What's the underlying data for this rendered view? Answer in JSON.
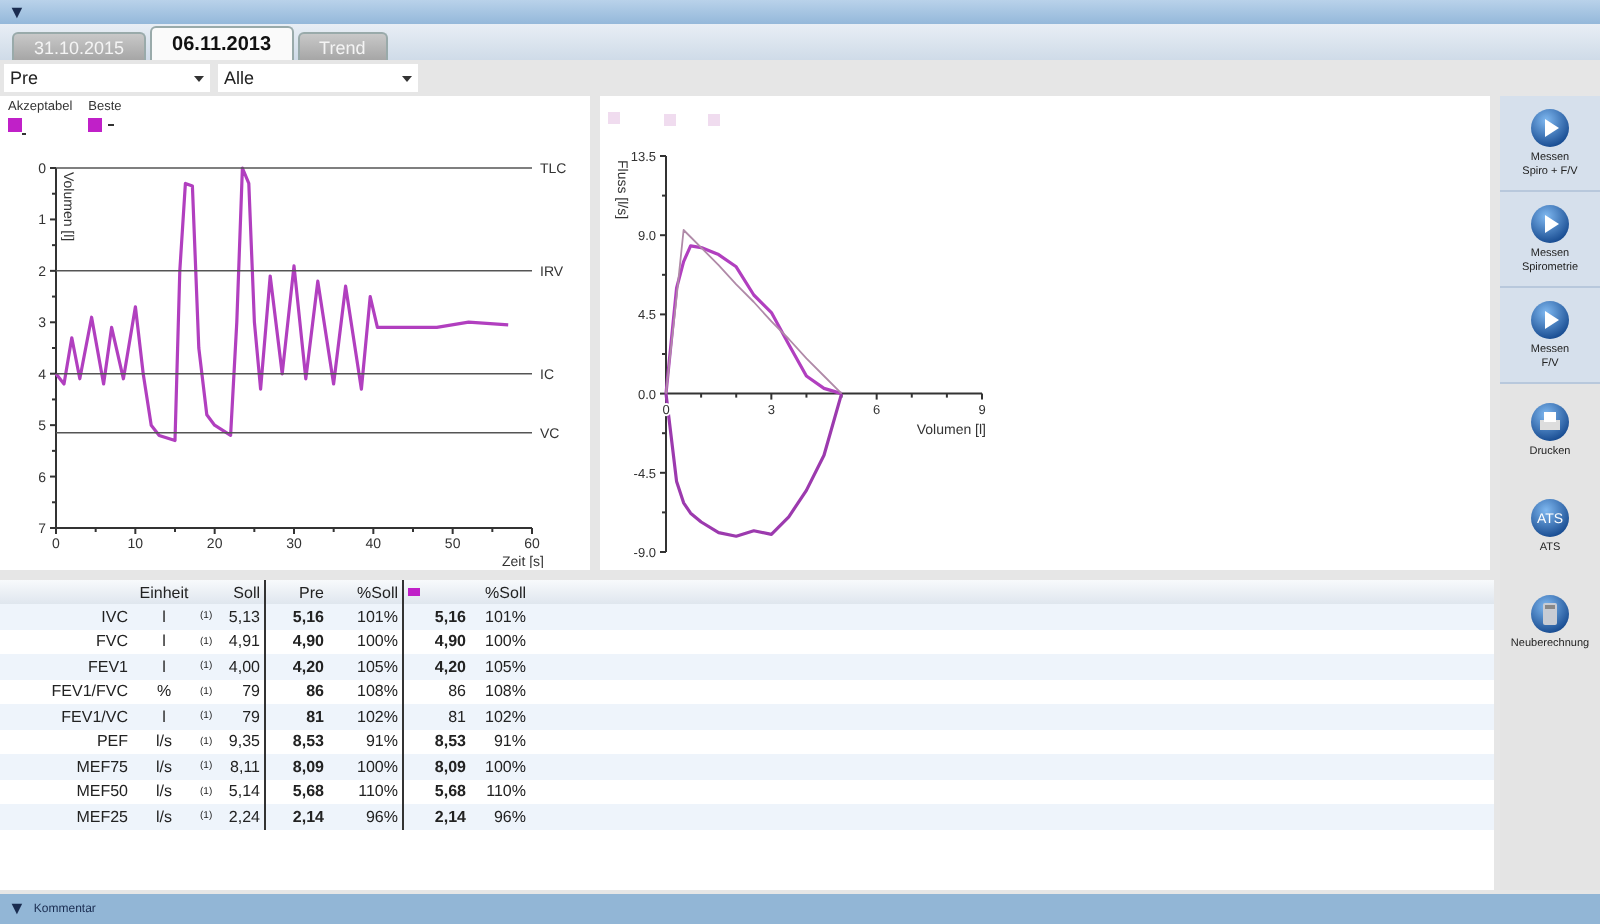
{
  "top_bar": {
    "glyph": "▼"
  },
  "tabs": [
    {
      "label": "31.10.2015",
      "selected": false
    },
    {
      "label": "06.11.2013",
      "selected": true
    },
    {
      "label": "Trend",
      "selected": false
    }
  ],
  "filters": [
    {
      "value": "Pre"
    },
    {
      "value": "Alle"
    }
  ],
  "volume_chart": {
    "legend": [
      {
        "label": "Akzeptabel",
        "kind": "accepted"
      },
      {
        "label": "Beste",
        "kind": "best"
      }
    ],
    "chart_data": {
      "type": "line",
      "xlabel": "Zeit [s]",
      "ylabel": "Volumen [l]",
      "x": [
        0,
        1,
        2,
        3,
        4.5,
        6,
        7,
        8.5,
        10,
        11,
        12,
        13,
        15,
        15.6,
        16.3,
        17.2,
        18,
        19,
        20,
        22,
        22.8,
        23.5,
        24.3,
        25,
        25.8,
        27,
        28.5,
        30,
        31.5,
        33,
        35,
        36.5,
        38.5,
        39.6,
        40.5,
        48,
        52,
        57,
        60
      ],
      "series": [
        {
          "color": "#b13fbf",
          "values": [
            4.0,
            4.2,
            3.3,
            4.1,
            2.9,
            4.2,
            3.1,
            4.1,
            2.7,
            4.0,
            5.0,
            5.2,
            5.3,
            2.0,
            0.3,
            0.35,
            3.5,
            4.8,
            5.0,
            5.2,
            3.0,
            0.0,
            0.3,
            3.0,
            4.3,
            2.1,
            4.0,
            1.9,
            4.1,
            2.2,
            4.2,
            2.3,
            4.3,
            2.5,
            3.1,
            3.1,
            3.0,
            3.05,
            null
          ]
        },
        {
          "name": "TLC",
          "color": "#555555",
          "values": [
            0,
            0,
            0,
            0,
            0,
            0,
            0,
            0,
            0,
            0,
            0,
            0,
            0,
            0,
            0,
            0,
            0,
            0,
            0,
            0,
            0,
            0,
            0,
            0,
            0,
            0,
            0,
            0,
            0,
            0,
            0,
            0,
            0,
            0,
            0,
            0,
            0,
            0,
            0
          ]
        },
        {
          "name": "IRV",
          "color": "#555555",
          "values": [
            2,
            2,
            2,
            2,
            2,
            2,
            2,
            2,
            2,
            2,
            2,
            2,
            2,
            2,
            2,
            2,
            2,
            2,
            2,
            2,
            2,
            2,
            2,
            2,
            2,
            2,
            2,
            2,
            2,
            2,
            2,
            2,
            2,
            2,
            2,
            2,
            2,
            2,
            2
          ]
        },
        {
          "name": "IC",
          "color": "#555555",
          "values": [
            4,
            4,
            4,
            4,
            4,
            4,
            4,
            4,
            4,
            4,
            4,
            4,
            4,
            4,
            4,
            4,
            4,
            4,
            4,
            4,
            4,
            4,
            4,
            4,
            4,
            4,
            4,
            4,
            4,
            4,
            4,
            4,
            4,
            4,
            4,
            4,
            4,
            4,
            4
          ]
        },
        {
          "name": "VC",
          "color": "#555555",
          "values": [
            5.15,
            5.15,
            5.15,
            5.15,
            5.15,
            5.15,
            5.15,
            5.15,
            5.15,
            5.15,
            5.15,
            5.15,
            5.15,
            5.15,
            5.15,
            5.15,
            5.15,
            5.15,
            5.15,
            5.15,
            5.15,
            5.15,
            5.15,
            5.15,
            5.15,
            5.15,
            5.15,
            5.15,
            5.15,
            5.15,
            5.15,
            5.15,
            5.15,
            5.15,
            5.15,
            5.15,
            5.15,
            5.15,
            5.15
          ]
        }
      ],
      "xlim": [
        0,
        60
      ],
      "ylim": [
        7,
        0
      ],
      "xticks": [
        0,
        10,
        20,
        30,
        40,
        50,
        60
      ],
      "yticks": [
        0,
        1,
        2,
        3,
        4,
        5,
        6,
        7
      ]
    }
  },
  "flow_chart": {
    "chart_data": {
      "type": "line",
      "xlabel": "Volumen [l]",
      "ylabel": "Fluss [l/s]",
      "x": [
        0,
        0.3,
        0.5,
        0.7,
        1,
        1.5,
        2,
        2.5,
        3,
        3.5,
        4,
        4.5,
        5
      ],
      "series": [
        {
          "color": "#b13fbf",
          "values": [
            0,
            6,
            7.5,
            8.4,
            8.3,
            7.9,
            7.2,
            5.6,
            4.6,
            2.8,
            1,
            0.3,
            0
          ]
        },
        {
          "color": "#9c3aae",
          "values": [
            0,
            -5,
            -6.2,
            -6.8,
            -7.3,
            -7.9,
            -8.1,
            -7.8,
            -8,
            -7,
            -5.5,
            -3.5,
            0
          ]
        },
        {
          "color": "#b08aa8",
          "values": [
            0,
            5.5,
            9.3,
            8.9,
            8.3,
            7.3,
            6.2,
            5.2,
            4.1,
            3.1,
            2.0,
            1.0,
            0
          ]
        }
      ],
      "xlim": [
        0,
        9
      ],
      "ylim": [
        -9,
        13.5
      ],
      "xticks": [
        0,
        3,
        6,
        9
      ],
      "yticks": [
        {
          "value": -9,
          "label": "-9.0"
        },
        {
          "value": -4.5,
          "label": "-4.5"
        },
        {
          "value": 0,
          "label": "0.0"
        },
        {
          "value": 4.5,
          "label": "4.5"
        },
        {
          "value": 9,
          "label": "9.0"
        },
        {
          "value": 13.5,
          "label": "13.5"
        }
      ]
    }
  },
  "sidebar": {
    "buttons": [
      {
        "label": "Messen\nSpiro + F/V",
        "kind": "play",
        "highlighted": true
      },
      {
        "label": "Messen\nSpirometrie",
        "kind": "play",
        "highlighted": true
      },
      {
        "label": "Messen\nF/V",
        "kind": "play",
        "highlighted": true
      },
      {
        "label": "Drucken",
        "kind": "print",
        "highlighted": false
      },
      {
        "label": "ATS",
        "kind": "ats",
        "icon_text": "ATS",
        "highlighted": false
      },
      {
        "label": "Neuberechnung",
        "kind": "calculator",
        "highlighted": false
      }
    ]
  },
  "table": {
    "columns": [
      {
        "label": "Einheit"
      },
      {
        "label": "Soll"
      },
      {
        "label": "Pre"
      },
      {
        "label": "%Soll"
      },
      {
        "kind": "marker",
        "color": "#c020c8"
      },
      {
        "label": "%Soll"
      }
    ],
    "rows": [
      {
        "label": "IVC",
        "unit": "l",
        "note": "(1)",
        "soll": "5,13",
        "pre": "5,16",
        "pre_pct": "101%",
        "best": "5,16",
        "best_bold": true,
        "best_pct": "101%"
      },
      {
        "label": "FVC",
        "unit": "l",
        "note": "(1)",
        "soll": "4,91",
        "pre": "4,90",
        "pre_pct": "100%",
        "best": "4,90",
        "best_bold": true,
        "best_pct": "100%"
      },
      {
        "label": "FEV1",
        "unit": "l",
        "note": "(1)",
        "soll": "4,00",
        "pre": "4,20",
        "pre_pct": "105%",
        "best": "4,20",
        "best_bold": true,
        "best_pct": "105%"
      },
      {
        "label": "FEV1/FVC",
        "unit": "%",
        "note": "(1)",
        "soll": "79",
        "pre": "86",
        "pre_pct": "108%",
        "best": "86",
        "best_bold": false,
        "best_pct": "108%"
      },
      {
        "label": "FEV1/VC",
        "unit": "l",
        "note": "(1)",
        "soll": "79",
        "pre": "81",
        "pre_pct": "102%",
        "best": "81",
        "best_bold": false,
        "best_pct": "102%"
      },
      {
        "label": "PEF",
        "unit": "l/s",
        "note": "(1)",
        "soll": "9,35",
        "pre": "8,53",
        "pre_pct": "91%",
        "best": "8,53",
        "best_bold": true,
        "best_pct": "91%"
      },
      {
        "label": "MEF75",
        "unit": "l/s",
        "note": "(1)",
        "soll": "8,11",
        "pre": "8,09",
        "pre_pct": "100%",
        "best": "8,09",
        "best_bold": true,
        "best_pct": "100%"
      },
      {
        "label": "MEF50",
        "unit": "l/s",
        "note": "(1)",
        "soll": "5,14",
        "pre": "5,68",
        "pre_pct": "110%",
        "best": "5,68",
        "best_bold": true,
        "best_pct": "110%"
      },
      {
        "label": "MEF25",
        "unit": "l/s",
        "note": "(1)",
        "soll": "2,24",
        "pre": "2,14",
        "pre_pct": "96%",
        "best": "2,14",
        "best_bold": true,
        "best_pct": "96%"
      }
    ]
  },
  "footer": {
    "glyph": "▼",
    "label": "Kommentar"
  }
}
